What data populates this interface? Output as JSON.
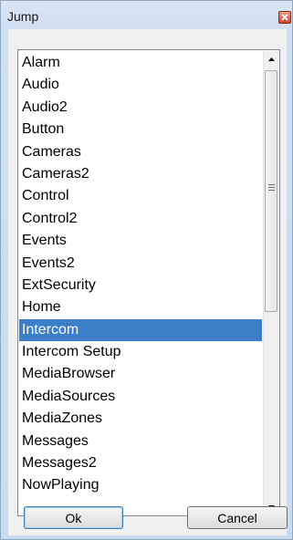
{
  "window": {
    "title": "Jump"
  },
  "list": {
    "items": [
      "Alarm",
      "Audio",
      "Audio2",
      "Button",
      "Cameras",
      "Cameras2",
      "Control",
      "Control2",
      "Events",
      "Events2",
      "ExtSecurity",
      "Home",
      "Intercom",
      "Intercom Setup",
      "MediaBrowser",
      "MediaSources",
      "MediaZones",
      "Messages",
      "Messages2",
      "NowPlaying"
    ],
    "selected": "Intercom"
  },
  "buttons": {
    "ok_label": "Ok",
    "cancel_label": "Cancel"
  },
  "colors": {
    "selection": "#3c7fc8",
    "close_button": "#c7432b"
  }
}
